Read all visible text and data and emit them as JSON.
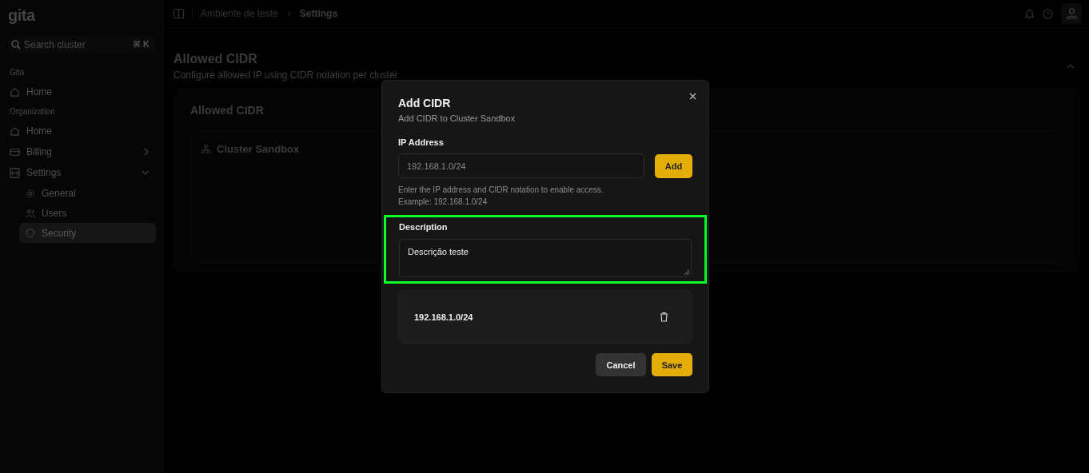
{
  "logo": "gita",
  "search": {
    "placeholder": "Search cluster",
    "shortcut": [
      "⌘",
      "K"
    ]
  },
  "sidebar": {
    "sections": [
      {
        "heading": "Gita",
        "items": [
          {
            "label": "Home",
            "selected": false
          }
        ]
      },
      {
        "heading": "Organization",
        "items": [
          {
            "label": "Home",
            "selected": false
          },
          {
            "label": "Billing",
            "expanded": false,
            "selected": false
          },
          {
            "label": "Settings",
            "expanded": true,
            "selected": false,
            "children": [
              {
                "label": "General",
                "selected": false
              },
              {
                "label": "Users",
                "selected": false
              },
              {
                "label": "Security",
                "selected": true
              }
            ]
          }
        ]
      }
    ]
  },
  "breadcrumb": [
    "Ambiente de teste",
    "Settings"
  ],
  "page": {
    "title": "Allowed CIDR",
    "subtitle": "Configure allowed IP using CIDR notation per cluster",
    "card_title": "Allowed CIDR",
    "cluster": "Cluster Sandbox"
  },
  "dialog": {
    "title": "Add CIDR",
    "subtitle": "Add CIDR to Cluster Sandbox",
    "ip_label": "IP Address",
    "ip_placeholder": "192.168.1.0/24",
    "add_button": "Add",
    "hint": [
      "Enter the IP address and CIDR notation to enable access.",
      "Example: 192.168.1.0/24"
    ],
    "description_label": "Description",
    "description_value": "Descrição teste",
    "description_highlighted": true,
    "entries": [
      {
        "cidr": "192.168.1.0/24"
      }
    ],
    "buttons": {
      "cancel": "Cancel",
      "save": "Save"
    }
  }
}
